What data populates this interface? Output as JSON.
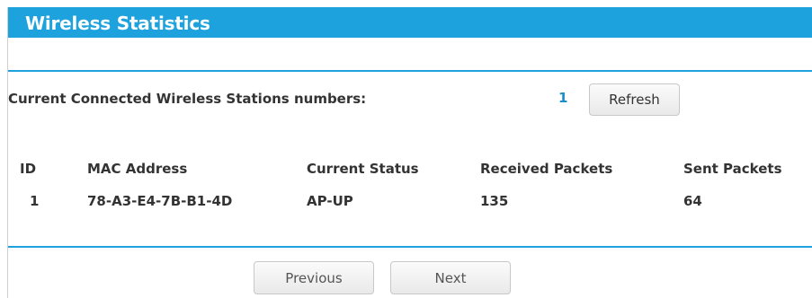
{
  "page": {
    "title": "Wireless Statistics"
  },
  "stations": {
    "label": "Current Connected Wireless Stations numbers:",
    "count": "1",
    "refresh_label": "Refresh"
  },
  "table": {
    "headers": {
      "id": "ID",
      "mac": "MAC Address",
      "status": "Current Status",
      "received": "Received Packets",
      "sent": "Sent Packets"
    },
    "rows": [
      {
        "id": "1",
        "mac": "78-A3-E4-7B-B1-4D",
        "status": "AP-UP",
        "received": "135",
        "sent": "64"
      }
    ]
  },
  "pagination": {
    "previous_label": "Previous",
    "next_label": "Next"
  },
  "colors": {
    "accent": "#1ea2dd",
    "count_text": "#1a8fc5"
  }
}
